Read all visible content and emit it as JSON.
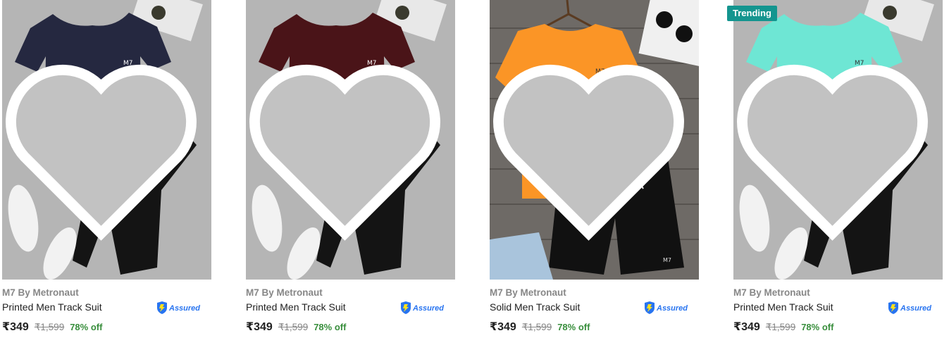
{
  "products": [
    {
      "brand": "M7 By Metronaut",
      "title": "Printed Men Track Suit",
      "price": "₹349",
      "mrp": "₹1,599",
      "discount": "78% off",
      "shirt_color": "#252840",
      "logo": "M7",
      "badge": "",
      "assured_icon": "flipkart-assured-icon",
      "assured_label": "Assured"
    },
    {
      "brand": "M7 By Metronaut",
      "title": "Printed Men Track Suit",
      "price": "₹349",
      "mrp": "₹1,599",
      "discount": "78% off",
      "shirt_color": "#4a1418",
      "logo": "M7",
      "badge": "",
      "assured_icon": "flipkart-assured-icon",
      "assured_label": "Assured"
    },
    {
      "brand": "M7 By Metronaut",
      "title": "Solid Men Track Suit",
      "price": "₹349",
      "mrp": "₹1,599",
      "discount": "78% off",
      "shirt_color": "#fb9526",
      "logo": "M7",
      "badge": "",
      "assured_icon": "flipkart-assured-icon",
      "assured_label": "Assured"
    },
    {
      "brand": "M7 By Metronaut",
      "title": "Printed Men Track Suit",
      "price": "₹349",
      "mrp": "₹1,599",
      "discount": "78% off",
      "shirt_color": "#6ee6d4",
      "logo": "M7",
      "badge": "Trending",
      "assured_icon": "flipkart-assured-icon",
      "assured_label": "Assured"
    }
  ]
}
